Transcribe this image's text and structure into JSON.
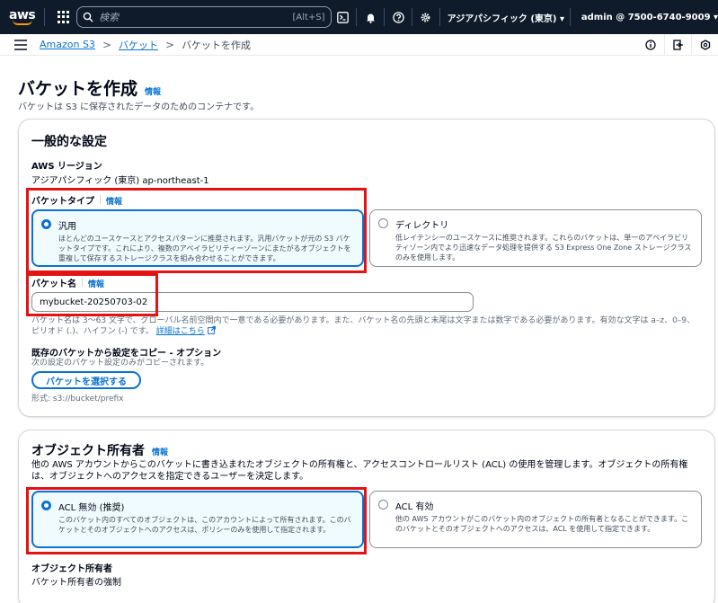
{
  "topnav": {
    "logo": "aws",
    "search_placeholder": "検索",
    "search_shortcut": "[Alt+S]",
    "region": "アジアパシフィック (東京) ▾",
    "account": "admin @ 7500-6740-9009 ▾"
  },
  "breadcrumb": {
    "items": [
      "Amazon S3",
      "バケット"
    ],
    "current": "バケットを作成"
  },
  "page": {
    "title": "バケットを作成",
    "info": "情報",
    "description": "バケットは S3 に保存されたデータのためのコンテナです。"
  },
  "general": {
    "heading": "一般的な設定",
    "region_label": "AWS リージョン",
    "region_value": "アジアパシフィック (東京) ap-northeast-1",
    "bucket_type_label": "バケットタイプ",
    "bucket_type_info": "情報",
    "bucket_types": [
      {
        "title": "汎用",
        "description": "ほとんどのユースケースとアクセスパターンに推奨されます。汎用バケットが元の S3 バケットタイプです。これにより、複数のアベイラビリティーゾーンにまたがるオブジェクトを重複して保存するストレージクラスを組み合わせることができます。",
        "selected": true
      },
      {
        "title": "ディレクトリ",
        "description": "低レイテンシーのユースケースに推奨されます。これらのバケットは、単一のアベイラビリティゾーン内でより迅速なデータ処理を提供する S3 Express One Zone ストレージクラスのみを使用します。",
        "selected": false
      }
    ],
    "bucket_name_label": "バケット名",
    "bucket_name_info": "情報",
    "bucket_name_value": "mybucket-20250703-02",
    "bucket_name_hint": "バケット名は 3～63 文字で、グローバル名前空間内で一意である必要があります。また、バケット名の先頭と末尾は文字または数字である必要があります。有効な文字は a–z、0–9、ピリオド (.)、ハイフン (-) です。",
    "bucket_name_hint_link": "詳細はこちら",
    "copy_label": "既存のバケットから設定をコピー - オプション",
    "copy_hint": "次の設定のバケット設定のみがコピーされます。",
    "choose_bucket_button": "バケットを選択する",
    "format_hint": "形式: s3://bucket/prefix"
  },
  "ownership": {
    "heading": "オブジェクト所有者",
    "info": "情報",
    "description": "他の AWS アカウントからこのバケットに書き込まれたオブジェクトの所有権と、アクセスコントロールリスト (ACL) の使用を管理します。オブジェクトの所有権は、オブジェクトへのアクセスを指定できるユーザーを決定します。",
    "options": [
      {
        "title": "ACL 無効 (推奨)",
        "description": "このバケット内のすべてのオブジェクトは、このアカウントによって所有されます。このバケットとそのオブジェクトへのアクセスは、ポリシーのみを使用して指定されます。",
        "selected": true
      },
      {
        "title": "ACL 有効",
        "description": "他の AWS アカウントがこのバケット内のオブジェクトの所有者となることができます。このバケットとそのオブジェクトへのアクセスは、ACL を使用して指定できます。",
        "selected": false
      }
    ],
    "owner_label": "オブジェクト所有者",
    "owner_value": "バケット所有者の強制"
  },
  "colors": {
    "nav_bg": "#0f1b2a",
    "link": "#0972d3",
    "highlight": "#e31313",
    "selected_bg": "#f0fbff"
  }
}
